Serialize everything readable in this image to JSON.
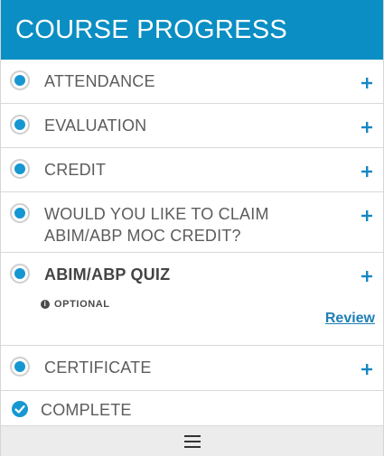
{
  "header": {
    "title": "COURSE PROGRESS"
  },
  "steps": [
    {
      "label": "ATTENDANCE",
      "icon": "plus-icon"
    },
    {
      "label": "EVALUATION",
      "icon": "plus-icon"
    },
    {
      "label": "CREDIT",
      "icon": "plus-icon"
    },
    {
      "label": "WOULD YOU LIKE TO CLAIM ABIM/ABP MOC CREDIT?",
      "icon": "plus-icon"
    },
    {
      "label": "ABIM/ABP QUIZ",
      "optional_label": "OPTIONAL",
      "link_label": "Review",
      "icon": "plus-icon"
    },
    {
      "label": "CERTIFICATE",
      "icon": "plus-icon"
    }
  ],
  "complete": {
    "label": "COMPLETE",
    "icon": "check-circle-icon"
  },
  "footer": {
    "menu_icon": "hamburger-menu-icon"
  },
  "colors": {
    "header_bg": "#0a8ec3",
    "accent": "#1697d2",
    "link": "#1f7fb5",
    "footer_bg": "#ececec"
  }
}
